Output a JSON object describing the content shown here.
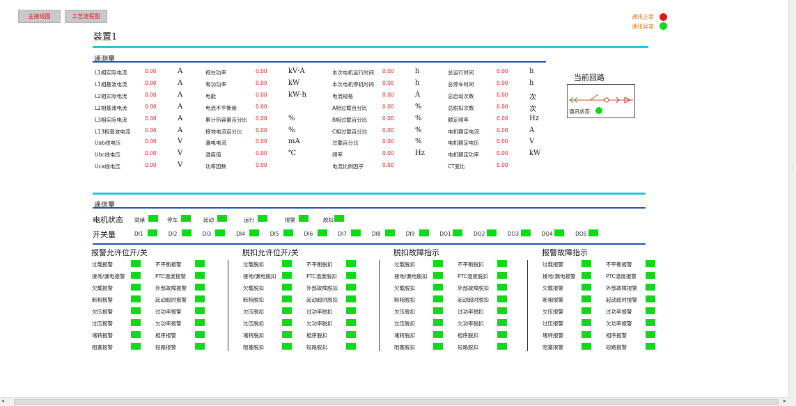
{
  "toolbar": {
    "btn_main": "主接线图",
    "btn_process": "工艺流程图"
  },
  "comm_legend": {
    "normal": "通讯正常",
    "abnormal": "通讯异常",
    "normal_color": "#e01818",
    "abnormal_color": "#12d81c"
  },
  "device_title": "装置1",
  "telemetry": {
    "title": "遥测量",
    "columns": [
      {
        "rows": [
          {
            "label": "L1相实际电流",
            "value": "0.00",
            "unit": "A"
          },
          {
            "label": "L1相基波电流",
            "value": "0.00",
            "unit": "A"
          },
          {
            "label": "L2相实际电流",
            "value": "0.00",
            "unit": "A"
          },
          {
            "label": "L2相基波电流",
            "value": "0.00",
            "unit": "A"
          },
          {
            "label": "L3相实际电流",
            "value": "0.00",
            "unit": "A"
          },
          {
            "label": "L13相基波电流",
            "value": "0.00",
            "unit": "A"
          },
          {
            "label": "Uab线电压",
            "value": "0.00",
            "unit": "V"
          },
          {
            "label": "Ubc线电压",
            "value": "0.00",
            "unit": "V"
          },
          {
            "label": "Uca线电压",
            "value": "0.00",
            "unit": "V"
          }
        ]
      },
      {
        "rows": [
          {
            "label": "视在功率",
            "value": "0.00",
            "unit": "kV·A"
          },
          {
            "label": "有功功率",
            "value": "0.00",
            "unit": "kW"
          },
          {
            "label": "电能",
            "value": "0.00",
            "unit": "kW·h"
          },
          {
            "label": "电流不平衡度",
            "value": "0.00",
            "unit": ""
          },
          {
            "label": "累计热容量百分比",
            "value": "0.00",
            "unit": "%"
          },
          {
            "label": "接地电流百分比",
            "value": "0.00",
            "unit": "%"
          },
          {
            "label": "漏电电流",
            "value": "0.00",
            "unit": "mA"
          },
          {
            "label": "温度值",
            "value": "0.00",
            "unit": "℃"
          },
          {
            "label": "功率因数",
            "value": "0.00",
            "unit": ""
          }
        ]
      },
      {
        "rows": [
          {
            "label": "本次电机运行时间",
            "value": "0.00",
            "unit": "h"
          },
          {
            "label": "本次电机停机时间",
            "value": "0.00",
            "unit": "h"
          },
          {
            "label": "电流规格",
            "value": "0.00",
            "unit": "A"
          },
          {
            "label": "A相过载百分比",
            "value": "0.00",
            "unit": "%"
          },
          {
            "label": "B相过载百分比",
            "value": "0.00",
            "unit": "%"
          },
          {
            "label": "C相过载百分比",
            "value": "0.00",
            "unit": "%"
          },
          {
            "label": "过载百分比",
            "value": "0.00",
            "unit": "%"
          },
          {
            "label": "频率",
            "value": "0.00",
            "unit": "Hz"
          },
          {
            "label": "电流比例因子",
            "value": "0.00",
            "unit": ""
          }
        ]
      },
      {
        "rows": [
          {
            "label": "总运行时间",
            "value": "0.00",
            "unit": "h"
          },
          {
            "label": "总停车时间",
            "value": "0.00",
            "unit": "h"
          },
          {
            "label": "总启动次数",
            "value": "0.00",
            "unit": "次"
          },
          {
            "label": "总脱扣次数",
            "value": "0.00",
            "unit": "次"
          },
          {
            "label": "额定频率",
            "value": "0.00",
            "unit": "Hz"
          },
          {
            "label": "电机额定电流",
            "value": "0.00",
            "unit": "A"
          },
          {
            "label": "电机额定电压",
            "value": "0.00",
            "unit": "V"
          },
          {
            "label": "电机额定功率",
            "value": "0.00",
            "unit": "kW"
          },
          {
            "label": "CT变比",
            "value": "0.00",
            "unit": ""
          }
        ]
      }
    ]
  },
  "circuit": {
    "title": "当前回路",
    "comm_status": "通讯状态"
  },
  "telesignal": {
    "title": "遥信量",
    "motor_status_label": "电机状态",
    "motor_status": [
      "就绪",
      "停车",
      "起动",
      "运行",
      "报警",
      "脱扣"
    ],
    "switch_label": "开关量",
    "switches": [
      "DI1",
      "DI2",
      "DI3",
      "DI4",
      "DI5",
      "DI6",
      "DI7",
      "DI8",
      "DI9",
      "DO1",
      "DO2",
      "DO3",
      "DO4",
      "DO5"
    ]
  },
  "groups": [
    {
      "title": "报警允许位开/关",
      "left": [
        "过载报警",
        "接地/漏电报警",
        "欠载报警",
        "断相报警",
        "欠压报警",
        "过压报警",
        "堵转报警",
        "阻塞报警"
      ],
      "right": [
        "不平衡报警",
        "PTC温度报警",
        "外部故障报警",
        "起动超时报警",
        "过功率报警",
        "欠功率报警",
        "相序报警",
        "短路报警"
      ]
    },
    {
      "title": "脱扣允许位开/关",
      "left": [
        "过载脱扣",
        "接地/漏电脱扣",
        "欠载脱扣",
        "断相脱扣",
        "欠压脱扣",
        "过压脱扣",
        "堵转脱扣",
        "阻塞脱扣"
      ],
      "right": [
        "不平衡脱扣",
        "PTC温度脱扣",
        "外部故障脱扣",
        "起动超时脱扣",
        "过功率脱扣",
        "欠功率脱扣",
        "相序脱扣",
        "短路脱扣"
      ]
    },
    {
      "title": "脱扣故障指示",
      "left": [
        "过载脱扣",
        "接地/漏电脱扣",
        "欠载脱扣",
        "断相脱扣",
        "欠压脱扣",
        "过压脱扣",
        "堵转脱扣",
        "阻塞脱扣"
      ],
      "right": [
        "不平衡脱扣",
        "PTC温度脱扣",
        "外部故障脱扣",
        "起动超时脱扣",
        "过功率脱扣",
        "欠功率脱扣",
        "相序脱扣",
        "短路脱扣"
      ]
    },
    {
      "title": "报警故障指示",
      "left": [
        "过载报警",
        "接地/漏电报警",
        "欠载报警",
        "断相报警",
        "欠压报警",
        "过压报警",
        "堵转报警",
        "阻塞报警"
      ],
      "right": [
        "不平衡报警",
        "PTC温度报警",
        "外部故障报警",
        "起动超时报警",
        "过功率报警",
        "欠功率报警",
        "相序报警",
        "短路报警"
      ]
    }
  ]
}
